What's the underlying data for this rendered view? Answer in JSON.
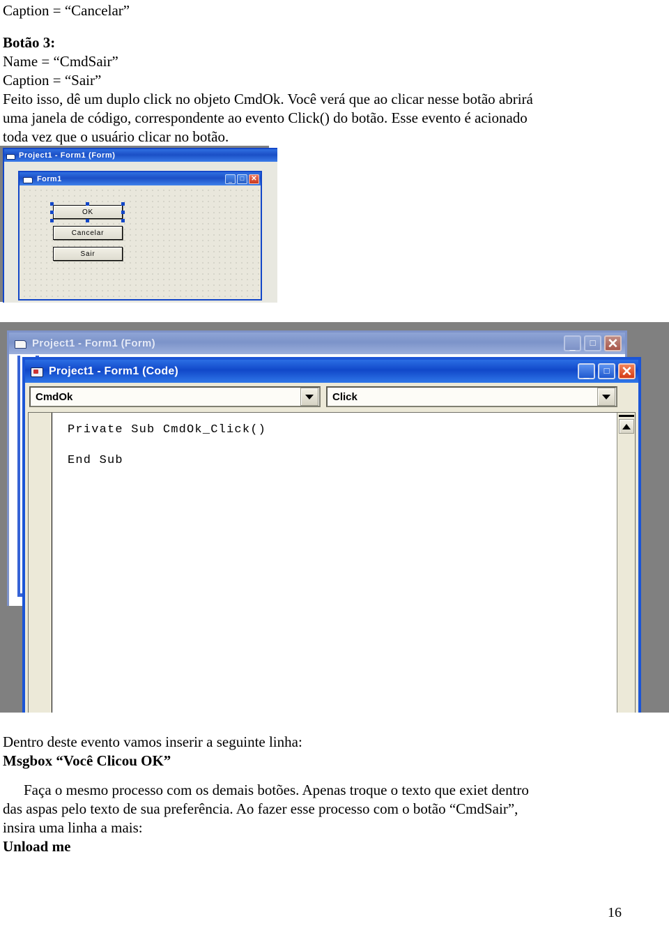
{
  "document": {
    "page_number": "16",
    "top_text": [
      {
        "text": "Caption = “Cancelar”",
        "bold": false
      },
      {
        "text": "",
        "bold": false
      },
      {
        "text": "Botão 3:",
        "bold": true
      },
      {
        "text": "Name = “CmdSair”",
        "bold": false
      },
      {
        "text": "Caption = “Sair”",
        "bold": false
      }
    ],
    "top_paragraph": [
      "Feito isso, dê um duplo click no objeto CmdOk. Você verá que ao clicar nesse botão abrirá",
      "uma janela de código, correspondente ao evento Click() do botão. Esse evento é acionado",
      "toda vez que o usuário clicar no botão."
    ],
    "bottom_text": [
      {
        "text": "Dentro deste evento vamos inserir a seguinte linha:",
        "bold": false
      },
      {
        "text": "Msgbox “Você Clicou OK”",
        "bold": true
      }
    ],
    "bottom_paragraph": [
      "Faça o mesmo processo com os demais botões. Apenas troque o texto que exiet dentro",
      "das aspas pelo texto de sua preferência. Ao fazer esse processo com o botão “CmdSair”,",
      "insira uma linha a mais:"
    ],
    "bottom_bold_last": "Unload me"
  },
  "screenshot_designer": {
    "mdi_window": {
      "title": "Project1 - Form1 (Form)",
      "icon": "form-window-icon"
    },
    "form_window": {
      "title": "Form1",
      "icon": "form-window-icon",
      "window_buttons": {
        "minimize": "_",
        "maximize": "□",
        "close": "✕"
      },
      "buttons": [
        {
          "caption": "OK",
          "selected": true
        },
        {
          "caption": "Cancelar",
          "selected": false
        },
        {
          "caption": "Sair",
          "selected": false
        }
      ]
    }
  },
  "screenshot_code": {
    "back_window": {
      "title": "Project1 - Form1 (Form)",
      "icon": "form-window-icon",
      "window_buttons": {
        "minimize": "_",
        "maximize": "□",
        "close": "✕"
      }
    },
    "code_window": {
      "title": "Project1 - Form1 (Code)",
      "icon": "code-module-icon",
      "window_buttons": {
        "minimize": "_",
        "maximize": "□",
        "close": "✕"
      },
      "object_combo": {
        "value": "CmdOk",
        "arrow_icon": "chevron-down-icon"
      },
      "event_combo": {
        "value": "Click",
        "arrow_icon": "chevron-down-icon"
      },
      "code_lines": [
        "Private Sub CmdOk_Click()",
        "",
        "End Sub"
      ],
      "scrollbar": {
        "up_arrow_icon": "triangle-up-icon"
      }
    }
  },
  "colors": {
    "xp_title_blue": "#1148c9",
    "xp_title_inactive": "#7c93c9",
    "close_red": "#d43a15",
    "vb_face": "#ece9d8",
    "designer_canvas": "#e9e7dc",
    "selection_handle": "#1347c8",
    "screenshot_backdrop": "#808080"
  }
}
